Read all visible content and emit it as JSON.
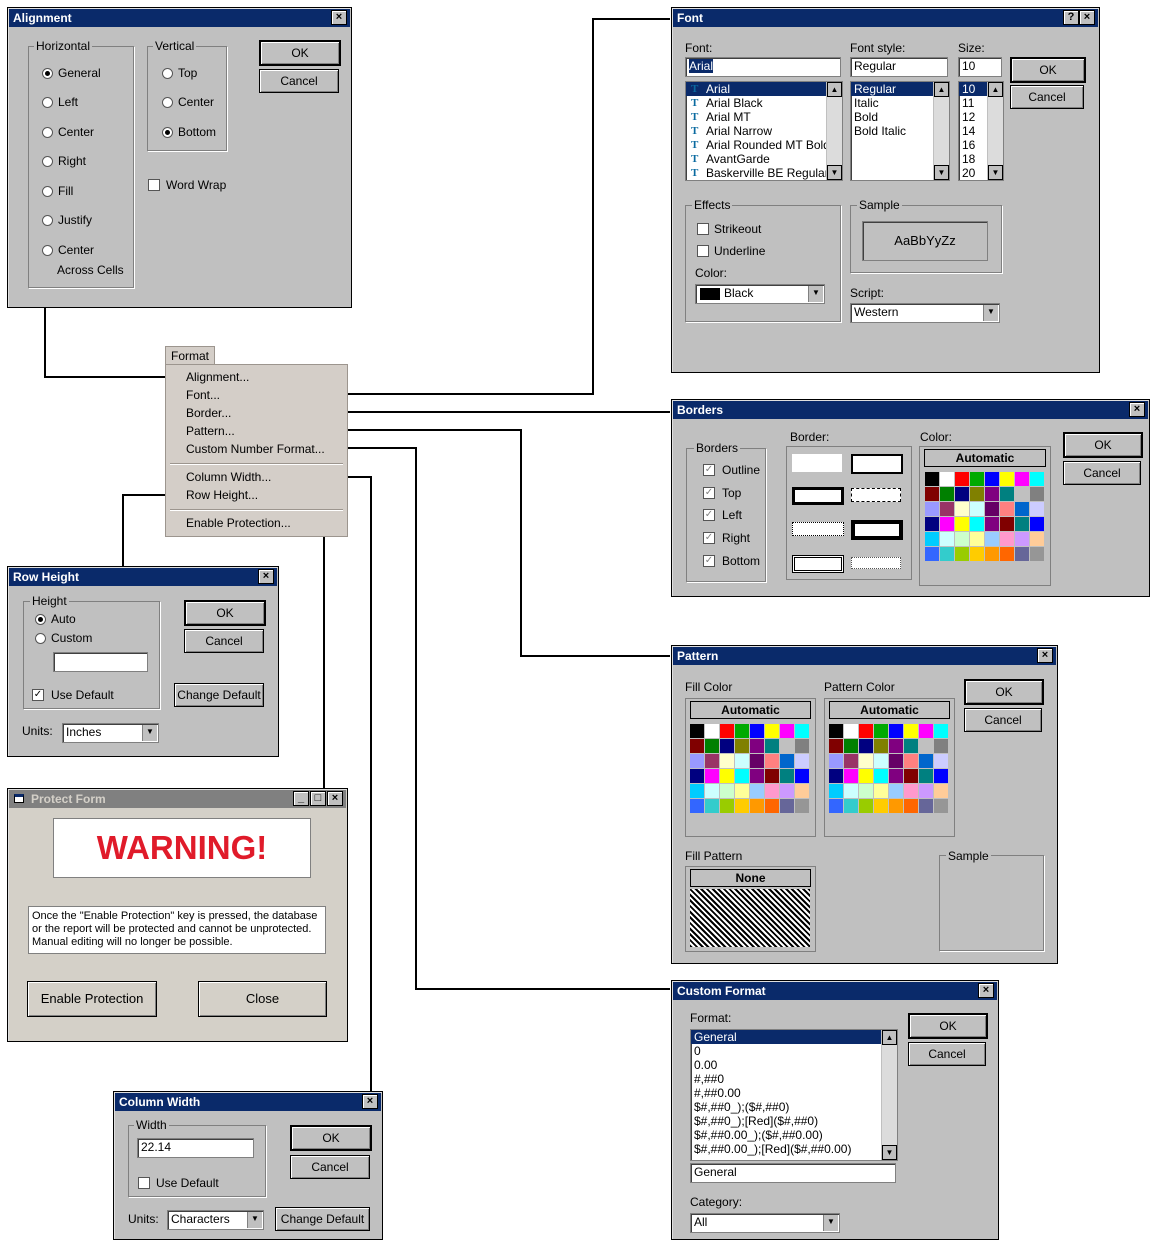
{
  "alignment": {
    "title": "Alignment",
    "horizontal_label": "Horizontal",
    "vertical_label": "Vertical",
    "horizontal_options": [
      "General",
      "Left",
      "Center",
      "Right",
      "Fill",
      "Justify",
      "Center"
    ],
    "across_cells": "Across Cells",
    "vertical_options": [
      "Top",
      "Center",
      "Bottom"
    ],
    "word_wrap": "Word Wrap",
    "ok": "OK",
    "cancel": "Cancel"
  },
  "menu": {
    "header": "Format",
    "items": [
      "Alignment...",
      "Font...",
      "Border...",
      "Pattern...",
      "Custom Number Format...",
      "Column Width...",
      "Row Height...",
      "Enable Protection..."
    ]
  },
  "font": {
    "title": "Font",
    "help_glyph": "?",
    "font_label": "Font:",
    "font_value": "Arial",
    "style_label": "Font style:",
    "style_value": "Regular",
    "size_label": "Size:",
    "size_value": "10",
    "fonts": [
      "Arial",
      "Arial Black",
      "Arial MT",
      "Arial Narrow",
      "Arial Rounded MT Bold",
      "AvantGarde",
      "Baskerville BE Regular"
    ],
    "styles": [
      "Regular",
      "Italic",
      "Bold",
      "Bold Italic"
    ],
    "sizes": [
      "10",
      "11",
      "12",
      "14",
      "16",
      "18",
      "20"
    ],
    "effects_label": "Effects",
    "strikeout": "Strikeout",
    "underline": "Underline",
    "color_label": "Color:",
    "color_value": "Black",
    "sample_label": "Sample",
    "sample_text": "AaBbYyZz",
    "script_label": "Script:",
    "script_value": "Western",
    "ok": "OK",
    "cancel": "Cancel"
  },
  "borders": {
    "title": "Borders",
    "group_label": "Borders",
    "options": [
      "Outline",
      "Top",
      "Left",
      "Right",
      "Bottom"
    ],
    "border_label": "Border:",
    "color_label": "Color:",
    "automatic": "Automatic",
    "ok": "OK",
    "cancel": "Cancel"
  },
  "pattern": {
    "title": "Pattern",
    "fill_color_label": "Fill Color",
    "pattern_color_label": "Pattern Color",
    "automatic": "Automatic",
    "fill_pattern_label": "Fill Pattern",
    "none": "None",
    "sample_label": "Sample",
    "ok": "OK",
    "cancel": "Cancel"
  },
  "custom_format": {
    "title": "Custom Format",
    "format_label": "Format:",
    "formats": [
      "General",
      "0",
      "0.00",
      "#,##0",
      "#,##0.00",
      "$#,##0_);($#,##0)",
      "$#,##0_);[Red]($#,##0)",
      "$#,##0.00_);($#,##0.00)",
      "$#,##0.00_);[Red]($#,##0.00)"
    ],
    "format_value": "General",
    "category_label": "Category:",
    "category_value": "All",
    "ok": "OK",
    "cancel": "Cancel"
  },
  "row_height": {
    "title": "Row Height",
    "height_label": "Height",
    "auto": "Auto",
    "custom": "Custom",
    "use_default": "Use Default",
    "units_label": "Units:",
    "units_value": "Inches",
    "ok": "OK",
    "cancel": "Cancel",
    "change_default": "Change Default"
  },
  "protect": {
    "title": "Protect Form",
    "warning": "WARNING!",
    "message": "Once the \"Enable Protection\" key is pressed, the database or the report will be protected and cannot be unprotected.  Manual editing will  no longer be possible.",
    "enable": "Enable Protection",
    "close": "Close",
    "min_glyph": "_",
    "max_glyph": "□",
    "close_glyph": "×"
  },
  "column_width": {
    "title": "Column Width",
    "width_label": "Width",
    "width_value": "22.14",
    "use_default": "Use Default",
    "units_label": "Units:",
    "units_value": "Characters",
    "ok": "OK",
    "cancel": "Cancel",
    "change_default": "Change Default"
  },
  "palette_colors": [
    "#000000",
    "#ffffff",
    "#ff0000",
    "#00aa00",
    "#0000ff",
    "#ffff00",
    "#ff00ff",
    "#00ffff",
    "#800000",
    "#008000",
    "#000080",
    "#808000",
    "#800080",
    "#008080",
    "#c0c0c0",
    "#808080",
    "#9999ff",
    "#993366",
    "#ffffcc",
    "#ccffff",
    "#660066",
    "#ff8080",
    "#0066cc",
    "#ccccff",
    "#000080",
    "#ff00ff",
    "#ffff00",
    "#00ffff",
    "#800080",
    "#800000",
    "#008080",
    "#0000ff",
    "#00ccff",
    "#ccffff",
    "#ccffcc",
    "#ffff99",
    "#99ccff",
    "#ff99cc",
    "#cc99ff",
    "#ffcc99",
    "#3366ff",
    "#33cccc",
    "#99cc00",
    "#ffcc00",
    "#ff9900",
    "#ff6600",
    "#666699",
    "#969696"
  ],
  "colors": {
    "title_bar": "#0a2a6a",
    "dialog": "#c0c0c0",
    "warning_red": "#e01b2a"
  }
}
